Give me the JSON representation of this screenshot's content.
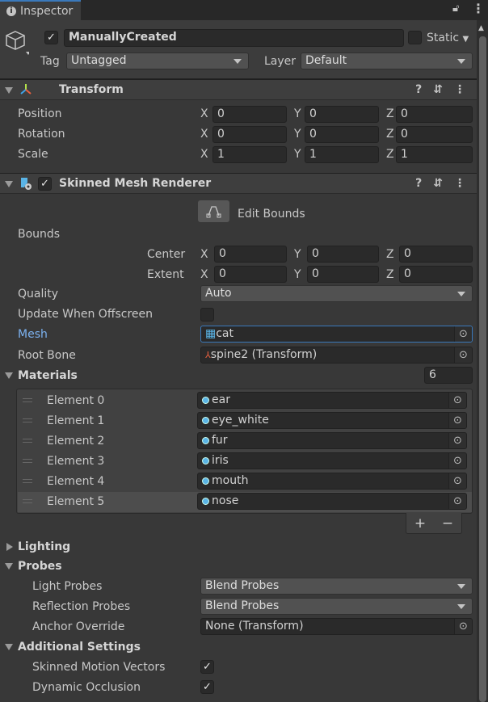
{
  "tab": {
    "title": "Inspector"
  },
  "object": {
    "active": true,
    "name": "ManuallyCreated",
    "static_label": "Static",
    "tag_label": "Tag",
    "tag": "Untagged",
    "layer_label": "Layer",
    "layer": "Default"
  },
  "transform": {
    "title": "Transform",
    "rows": [
      {
        "label": "Position",
        "x": "0",
        "y": "0",
        "z": "0"
      },
      {
        "label": "Rotation",
        "x": "0",
        "y": "0",
        "z": "0"
      },
      {
        "label": "Scale",
        "x": "1",
        "y": "1",
        "z": "1"
      }
    ]
  },
  "axes": {
    "x": "X",
    "y": "Y",
    "z": "Z"
  },
  "smr": {
    "title": "Skinned Mesh Renderer",
    "enabled": true,
    "edit_bounds": "Edit Bounds",
    "bounds_label": "Bounds",
    "center": {
      "label": "Center",
      "x": "0",
      "y": "0",
      "z": "0"
    },
    "extent": {
      "label": "Extent",
      "x": "0",
      "y": "0",
      "z": "0"
    },
    "quality_label": "Quality",
    "quality": "Auto",
    "update_offscreen_label": "Update When Offscreen",
    "update_offscreen": false,
    "mesh_label": "Mesh",
    "mesh": "cat",
    "root_bone_label": "Root Bone",
    "root_bone": "spine2 (Transform)",
    "materials_label": "Materials",
    "materials_size": "6",
    "materials": [
      {
        "label": "Element 0",
        "value": "ear"
      },
      {
        "label": "Element 1",
        "value": "eye_white"
      },
      {
        "label": "Element 2",
        "value": "fur"
      },
      {
        "label": "Element 3",
        "value": "iris"
      },
      {
        "label": "Element 4",
        "value": "mouth"
      },
      {
        "label": "Element 5",
        "value": "nose"
      }
    ],
    "add": "+",
    "remove": "−",
    "lighting_label": "Lighting",
    "probes_label": "Probes",
    "light_probes_label": "Light Probes",
    "light_probes": "Blend Probes",
    "reflection_probes_label": "Reflection Probes",
    "reflection_probes": "Blend Probes",
    "anchor_override_label": "Anchor Override",
    "anchor_override": "None (Transform)",
    "additional_label": "Additional Settings",
    "skinned_motion_label": "Skinned Motion Vectors",
    "skinned_motion": true,
    "dynamic_occlusion_label": "Dynamic Occlusion",
    "dynamic_occlusion": true
  },
  "colors": {
    "accent": "#3a79bb",
    "mesh_label": "#7cb2f0",
    "background": "#383838"
  }
}
